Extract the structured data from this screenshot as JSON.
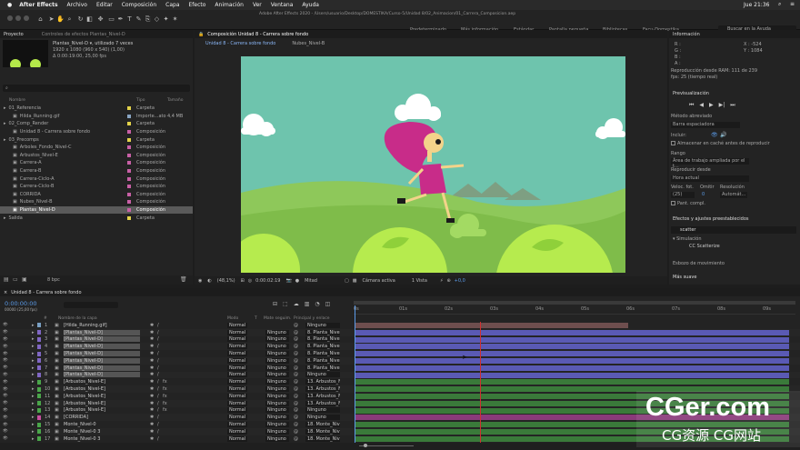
{
  "menu": {
    "apple": "",
    "app": "After Effects",
    "items": [
      "Archivo",
      "Editar",
      "Composición",
      "Capa",
      "Efecto",
      "Animación",
      "Ver",
      "Ventana",
      "Ayuda"
    ],
    "time": "Jue 21:36"
  },
  "title_path": "Adobe After Effects 2020 - /Users/usuario/Desktop/DOMESTIKA/Curso-5/Unidad 8/02_Animacion/01_Carrera_Composicion.aep",
  "workspaces": [
    "Predeterminado",
    "Más información",
    "Estándar",
    "Pantalla pequeña",
    "Bibliotecas",
    "Facu-Domestika"
  ],
  "search_help": "Buscar en la Ayuda",
  "project": {
    "tab1": "Proyecto",
    "tab2": "Controles de efectos Plantas_Nivel-D",
    "item_name": "Plantas_Nivel-D ▾, utilizado 7 veces",
    "item_dims": "1920 x 1080 (960 x 540) (1,00)",
    "item_time": "Δ 0:00:19:00, 25,00 fps",
    "search_placeholder": "⌕",
    "cols": [
      "Nombre",
      "Tipo",
      "Tamaño"
    ],
    "rows": [
      {
        "name": "01_Referencia",
        "type": "Carpeta",
        "size": "",
        "indent": 0,
        "color": "#e3d34a",
        "sel": false
      },
      {
        "name": "Hilda_Running.gif",
        "type": "Importe...ato",
        "size": "4,4 MB",
        "indent": 1,
        "color": "#8aa6c4",
        "sel": false
      },
      {
        "name": "02_Comp_Render",
        "type": "Carpeta",
        "size": "",
        "indent": 0,
        "color": "#e3d34a",
        "sel": false
      },
      {
        "name": "Unidad 8 - Carrera sobre fondo",
        "type": "Composición",
        "size": "",
        "indent": 1,
        "color": "#c860a6",
        "sel": false
      },
      {
        "name": "03_Precomps",
        "type": "Carpeta",
        "size": "",
        "indent": 0,
        "color": "#e3d34a",
        "sel": false
      },
      {
        "name": "Arboles_Fondo_Nivel-C",
        "type": "Composición",
        "size": "",
        "indent": 1,
        "color": "#c860a6",
        "sel": false
      },
      {
        "name": "Arbustos_Nivel-E",
        "type": "Composición",
        "size": "",
        "indent": 1,
        "color": "#c860a6",
        "sel": false
      },
      {
        "name": "Carrera-A",
        "type": "Composición",
        "size": "",
        "indent": 1,
        "color": "#c860a6",
        "sel": false
      },
      {
        "name": "Carrera-B",
        "type": "Composición",
        "size": "",
        "indent": 1,
        "color": "#c860a6",
        "sel": false
      },
      {
        "name": "Carrera-Ciclo-A",
        "type": "Composición",
        "size": "",
        "indent": 1,
        "color": "#c860a6",
        "sel": false
      },
      {
        "name": "Carrera-Ciclo-B",
        "type": "Composición",
        "size": "",
        "indent": 1,
        "color": "#c860a6",
        "sel": false
      },
      {
        "name": "CORRIDA",
        "type": "Composición",
        "size": "",
        "indent": 1,
        "color": "#c860a6",
        "sel": false
      },
      {
        "name": "Nubes_Nivel-B",
        "type": "Composición",
        "size": "",
        "indent": 1,
        "color": "#c860a6",
        "sel": false
      },
      {
        "name": "Plantas_Nivel-D",
        "type": "Composición",
        "size": "",
        "indent": 1,
        "color": "#c860a6",
        "sel": true
      },
      {
        "name": "Salida",
        "type": "Carpeta",
        "size": "",
        "indent": 0,
        "color": "#e3d34a",
        "sel": false
      }
    ],
    "bpc": "8 bpc"
  },
  "comp": {
    "tab": "Composición Unidad 8 - Carrera sobre fondo",
    "sub1": "Unidad 8 - Carrera sobre fondo",
    "sub2": "Nubes_Nivel-B",
    "zoom": "(48,1%)",
    "time": "0:00:02:19",
    "res": "Mitad",
    "camera": "Cámara activa",
    "views": "1 Vista",
    "exposure": "+0,0"
  },
  "right": {
    "info": "Información",
    "r": "R :",
    "g": "G :",
    "b": "B :",
    "a": "A :",
    "x": "X : -524",
    "y": "Y : 1084",
    "ram": "Reproducción desde RAM: 111 de 239",
    "fps": "fps: 25 (tiempo real)",
    "preview": "Previsualización",
    "shortcut_lbl": "Método abreviado",
    "shortcut": "Barra espaciadora",
    "include": "Incluir:",
    "cache": "Almacenar en caché antes de reproducir",
    "range_lbl": "Rango",
    "range": "Área de trabajo ampliada por el t...",
    "play_from_lbl": "Reproducir desde",
    "play_from": "Hora actual",
    "fps_lbl": "Veloc. fot.",
    "skip_lbl": "Omitir",
    "res_lbl": "Resolución",
    "fps_v": "(25)",
    "skip_v": "0",
    "res_v": "Automát...",
    "full": "Pant. compl.",
    "effects": "Efectos y ajustes preestablecidos",
    "effects_search": "scatter",
    "sim": "▾ Simulación",
    "cc": "CC Scatterize",
    "motion": "Esbozo de movimiento",
    "smoother": "Más suave"
  },
  "timeline": {
    "tab": "Unidad 8 - Carrera sobre fondo",
    "time": "0:00:00:00",
    "frames": "00000 (25,00 fps)",
    "cols": [
      "#",
      "Nombre de la capa",
      "Modo",
      "T",
      "Mate seguim.",
      "Principal y enlace"
    ],
    "ticks": [
      "0s",
      "01s",
      "02s",
      "03s",
      "04s",
      "05s",
      "06s",
      "07s",
      "08s",
      "09s"
    ],
    "layers": [
      {
        "n": "1",
        "name": "[Hilda_Running.gif]",
        "mode": "Normal",
        "mate": "",
        "parent": "Ninguno",
        "color": "#7aa0c4",
        "bar": "#6e4e4e",
        "sel": false,
        "fx": false
      },
      {
        "n": "2",
        "name": "[Plantas_Nivel-D]",
        "mode": "Normal",
        "mate": "Ninguno",
        "parent": "8. Planta_Nive",
        "color": "#8067c4",
        "bar": "#5a5ab4",
        "sel": true,
        "fx": false
      },
      {
        "n": "3",
        "name": "[Plantas_Nivel-D]",
        "mode": "Normal",
        "mate": "Ninguno",
        "parent": "8. Planta_Nive",
        "color": "#8067c4",
        "bar": "#5a5ab4",
        "sel": true,
        "fx": false
      },
      {
        "n": "4",
        "name": "[Plantas_Nivel-D]",
        "mode": "Normal",
        "mate": "Ninguno",
        "parent": "8. Planta_Nive",
        "color": "#8067c4",
        "bar": "#5a5ab4",
        "sel": true,
        "fx": false
      },
      {
        "n": "5",
        "name": "[Plantas_Nivel-D]",
        "mode": "Normal",
        "mate": "Ninguno",
        "parent": "8. Planta_Nive",
        "color": "#8067c4",
        "bar": "#5a5ab4",
        "sel": true,
        "fx": false
      },
      {
        "n": "6",
        "name": "[Plantas_Nivel-D]",
        "mode": "Normal",
        "mate": "Ninguno",
        "parent": "8. Planta_Nive",
        "color": "#8067c4",
        "bar": "#5a5ab4",
        "sel": true,
        "fx": false
      },
      {
        "n": "7",
        "name": "[Plantas_Nivel-D]",
        "mode": "Normal",
        "mate": "Ninguno",
        "parent": "8. Planta_Nive",
        "color": "#8067c4",
        "bar": "#5a5ab4",
        "sel": true,
        "fx": false
      },
      {
        "n": "8",
        "name": "[Plantas_Nivel-D]",
        "mode": "Normal",
        "mate": "Ninguno",
        "parent": "Ninguno",
        "color": "#8067c4",
        "bar": "#5a5ab4",
        "sel": true,
        "fx": false
      },
      {
        "n": "9",
        "name": "[Arbustos_Nivel-E]",
        "mode": "Normal",
        "mate": "Ninguno",
        "parent": "13. Arbustos_N",
        "color": "#4aa64a",
        "bar": "#3a7a3a",
        "sel": false,
        "fx": true
      },
      {
        "n": "10",
        "name": "[Arbustos_Nivel-E]",
        "mode": "Normal",
        "mate": "Ninguno",
        "parent": "13. Arbustos_N",
        "color": "#4aa64a",
        "bar": "#3a7a3a",
        "sel": false,
        "fx": true
      },
      {
        "n": "11",
        "name": "[Arbustos_Nivel-E]",
        "mode": "Normal",
        "mate": "Ninguno",
        "parent": "13. Arbustos_N",
        "color": "#4aa64a",
        "bar": "#3a7a3a",
        "sel": false,
        "fx": true
      },
      {
        "n": "12",
        "name": "[Arbustos_Nivel-E]",
        "mode": "Normal",
        "mate": "Ninguno",
        "parent": "13. Arbustos_N",
        "color": "#4aa64a",
        "bar": "#3a7a3a",
        "sel": false,
        "fx": true
      },
      {
        "n": "13",
        "name": "[Arbustos_Nivel-E]",
        "mode": "Normal",
        "mate": "Ninguno",
        "parent": "Ninguno",
        "color": "#4aa64a",
        "bar": "#3a7a3a",
        "sel": false,
        "fx": true
      },
      {
        "n": "14",
        "name": "[CORRIDA]",
        "mode": "Normal",
        "mate": "Ninguno",
        "parent": "Ninguno",
        "color": "#c850a0",
        "bar": "#8a3a7a",
        "sel": false,
        "fx": false
      },
      {
        "n": "15",
        "name": "Monte_Nivel-0",
        "mode": "Normal",
        "mate": "Ninguno",
        "parent": "18. Monte_Nive",
        "color": "#4aa64a",
        "bar": "#3a7a3a",
        "sel": false,
        "fx": false
      },
      {
        "n": "16",
        "name": "Monte_Nivel-0 3",
        "mode": "Normal",
        "mate": "Ninguno",
        "parent": "18. Monte_Nive",
        "color": "#4aa64a",
        "bar": "#3a7a3a",
        "sel": false,
        "fx": false
      },
      {
        "n": "17",
        "name": "Monte_Nivel-0 3",
        "mode": "Normal",
        "mate": "Ninguno",
        "parent": "18. Monte_Nive",
        "color": "#4aa64a",
        "bar": "#3a7a3a",
        "sel": false,
        "fx": false
      }
    ]
  },
  "watermark": {
    "big": "CGer.com",
    "small": "CG资源 CG网站"
  }
}
